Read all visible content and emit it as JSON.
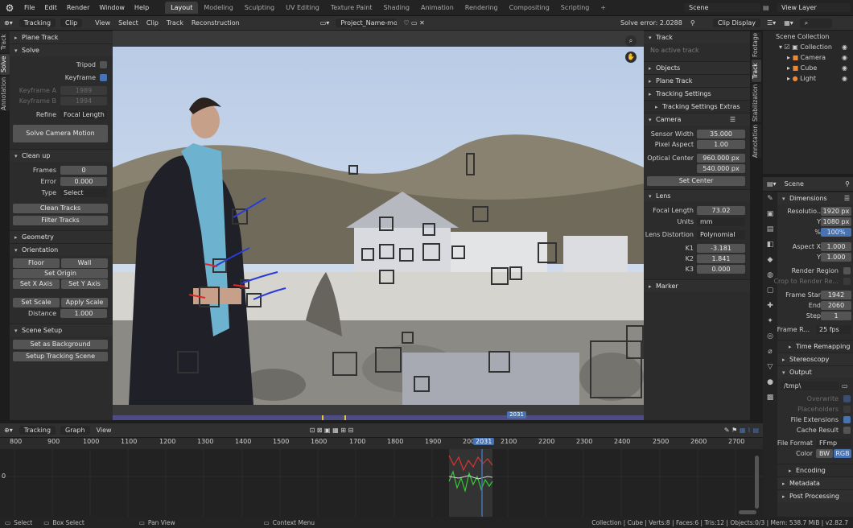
{
  "topbar": {
    "menus": [
      "File",
      "Edit",
      "Render",
      "Window",
      "Help"
    ],
    "workspaces": [
      "Layout",
      "Modeling",
      "Sculpting",
      "UV Editing",
      "Texture Paint",
      "Shading",
      "Animation",
      "Rendering",
      "Compositing",
      "Scripting"
    ],
    "active_workspace": "Layout",
    "scene": "Scene",
    "view_layer": "View Layer",
    "add_tab": "+"
  },
  "clip_header": {
    "mode": "Tracking",
    "view": "Clip",
    "menus": [
      "View",
      "Select",
      "Clip",
      "Track",
      "Reconstruction"
    ],
    "clip_name": "Project_Name-mont...",
    "solve_error": "Solve error: 2.0288",
    "display": "Clip Display"
  },
  "left_tabs": [
    "Track",
    "Solve",
    "Annotation"
  ],
  "tool": {
    "plane_track": "Plane Track",
    "solve": {
      "title": "Solve",
      "tripod": "Tripod",
      "keyframe": "Keyframe",
      "keyframe_a_label": "Keyframe A",
      "keyframe_a": "1989",
      "keyframe_b_label": "Keyframe B",
      "keyframe_b": "1994",
      "refine_label": "Refine",
      "refine": "Focal Length",
      "solve_button": "Solve Camera Motion"
    },
    "cleanup": {
      "title": "Clean up",
      "frames_label": "Frames",
      "frames": "0",
      "error_label": "Error",
      "error": "0.000",
      "type_label": "Type",
      "type": "Select",
      "clean_tracks": "Clean Tracks",
      "filter_tracks": "Filter Tracks"
    },
    "geometry": "Geometry",
    "orientation": {
      "title": "Orientation",
      "floor": "Floor",
      "wall": "Wall",
      "set_origin": "Set Origin",
      "set_x": "Set X Axis",
      "set_y": "Set Y Axis",
      "set_scale": "Set Scale",
      "apply_scale": "Apply Scale",
      "distance_label": "Distance",
      "distance": "1.000"
    },
    "scene_setup": {
      "title": "Scene Setup",
      "background": "Set as Background",
      "tracking_scene": "Setup Tracking Scene"
    }
  },
  "sidebar": {
    "track": {
      "title": "Track",
      "empty": "No active track"
    },
    "objects": "Objects",
    "plane_track": "Plane Track",
    "tracking_settings": "Tracking Settings",
    "tracking_extras": "Tracking Settings Extras",
    "camera": {
      "title": "Camera",
      "sensor_label": "Sensor Width",
      "sensor": "35.000",
      "aspect_label": "Pixel Aspect",
      "aspect": "1.00",
      "optical_label": "Optical Center",
      "optical_x": "960.000 px",
      "optical_y": "540.000 px",
      "set_center": "Set Center"
    },
    "lens": {
      "title": "Lens",
      "focal_label": "Focal Length",
      "focal": "73.02",
      "units_label": "Units",
      "units": "mm",
      "distortion_label": "Lens Distortion",
      "distortion": "Polynomial",
      "k1_label": "K1",
      "k1": "-3.181",
      "k2_label": "K2",
      "k2": "1.841",
      "k3_label": "K3",
      "k3": "0.000"
    },
    "marker": "Marker",
    "tabs": [
      "Footage",
      "Track",
      "Stabilization",
      "Annotation"
    ]
  },
  "outliner": {
    "title": "Scene Collection",
    "items": [
      {
        "name": "Collection"
      },
      {
        "name": "Camera"
      },
      {
        "name": "Cube"
      },
      {
        "name": "Light"
      }
    ]
  },
  "properties": {
    "scene": "Scene",
    "dimensions": "Dimensions",
    "res_label": "Resolutio..",
    "res_x": "1920 px",
    "res_y_label": "Y",
    "res_y": "1080 px",
    "pct_label": "%",
    "pct": "100%",
    "aspx_label": "Aspect X",
    "aspx": "1.000",
    "aspy_label": "Y",
    "aspy": "1.000",
    "render_region": "Render Region",
    "crop": "Crop to Render Re...",
    "fstart_label": "Frame Star",
    "fstart": "1942",
    "fend_label": "End",
    "fend": "2060",
    "step_label": "Step",
    "step": "1",
    "fps_label": "Frame R...",
    "fps": "25 fps",
    "time_remap": "Time Remapping",
    "stereoscopy": "Stereoscopy",
    "output": "Output",
    "path": "/tmp\\",
    "overwrite": "Overwrite",
    "placeholders": "Placeholders",
    "file_ext": "File Extensions",
    "cache": "Cache Result",
    "format_label": "File Format",
    "format": "FFmp",
    "color_label": "Color",
    "bw": "BW",
    "rgb": "RGB",
    "encoding": "Encoding",
    "metadata": "Metadata",
    "post": "Post Processing"
  },
  "graph": {
    "mode": "Tracking",
    "view": "Graph",
    "menu": "View",
    "current_frame": "2031",
    "ruler": [
      "800",
      "900",
      "1000",
      "1100",
      "1200",
      "1300",
      "1400",
      "1500",
      "1600",
      "1700",
      "1800",
      "1900",
      "2000",
      "2031",
      "2100",
      "2200",
      "2300",
      "2400",
      "2500",
      "2600",
      "2700"
    ],
    "zero": "0"
  },
  "timeline": {
    "frame": "2031"
  },
  "status": {
    "select": "Select",
    "box": "Box Select",
    "pan": "Pan View",
    "context": "Context Menu",
    "info": "Collection | Cube | Verts:8 | Faces:6 | Tris:12 | Objects:0/3 | Mem: 538.7 MiB | v2.82.7"
  }
}
